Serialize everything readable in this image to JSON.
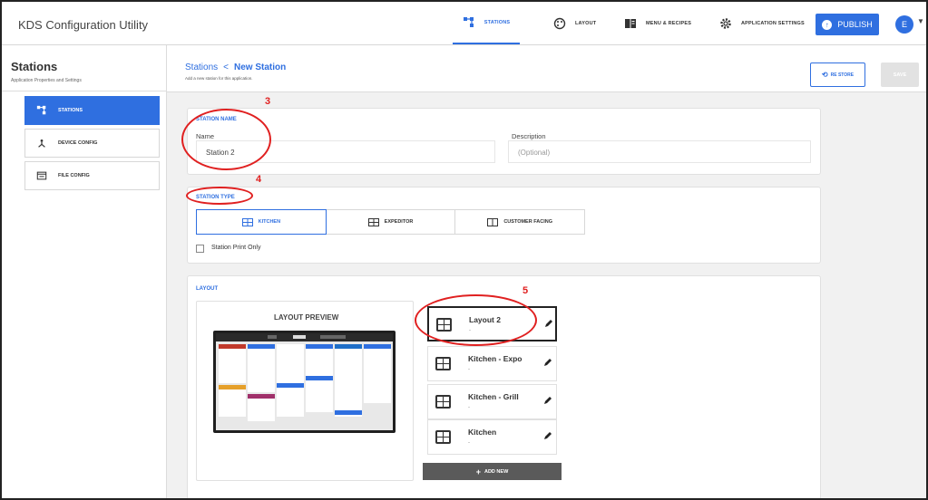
{
  "app": {
    "title": "KDS Configuration Utility"
  },
  "nav": {
    "tabs": [
      {
        "label": "STATIONS",
        "icon": "stations-icon",
        "active": true
      },
      {
        "label": "LAYOUT",
        "icon": "palette-icon",
        "active": false
      },
      {
        "label": "MENU & RECIPES",
        "icon": "book-icon",
        "active": false
      },
      {
        "label": "APPLICATION SETTINGS",
        "icon": "gear-icon",
        "active": false
      }
    ],
    "publish_label": "PUBLISH",
    "avatar_initial": "E"
  },
  "sidebar": {
    "title": "Stations",
    "subtitle": "Application Properties and Settings",
    "items": [
      {
        "label": "STATIONS",
        "icon": "stations-icon",
        "active": true
      },
      {
        "label": "DEVICE CONFIG",
        "icon": "device-config-icon",
        "active": false
      },
      {
        "label": "FILE CONFIG",
        "icon": "file-config-icon",
        "active": false
      }
    ]
  },
  "header": {
    "breadcrumb_parent": "Stations",
    "breadcrumb_separator": "<",
    "breadcrumb_current": "New Station",
    "subtitle": "Add a new station for this application.",
    "restore_label": "RE STORE",
    "save_label": "SAVE"
  },
  "station_name": {
    "section_title": "STATION NAME",
    "name_label": "Name",
    "name_value": "Station 2",
    "description_label": "Description",
    "description_placeholder": "(Optional)"
  },
  "station_type": {
    "section_title": "STATION TYPE",
    "options": [
      {
        "label": "KITCHEN",
        "active": true
      },
      {
        "label": "EXPEDITOR",
        "active": false
      },
      {
        "label": "CUSTOMER FACING",
        "active": false
      }
    ],
    "print_only_label": "Station Print Only",
    "print_only_checked": false
  },
  "layout": {
    "section_title": "LAYOUT",
    "preview_title": "LAYOUT PREVIEW",
    "items": [
      {
        "name": "Layout 2",
        "sub": "-",
        "selected": true
      },
      {
        "name": "Kitchen - Expo",
        "sub": "-",
        "selected": false
      },
      {
        "name": "Kitchen - Grill",
        "sub": "-",
        "selected": false
      },
      {
        "name": "Kitchen",
        "sub": "-",
        "selected": false
      }
    ],
    "add_new_label": "ADD NEW"
  },
  "annotations": {
    "n3": "3",
    "n4": "4",
    "n5": "5"
  },
  "colors": {
    "accent": "#2f6fe0",
    "annotation": "#e02020",
    "tab_colors": [
      "#c0392b",
      "#2f6fe0",
      "#e6a02a",
      "#a0306a",
      "#1f6fc8"
    ]
  }
}
